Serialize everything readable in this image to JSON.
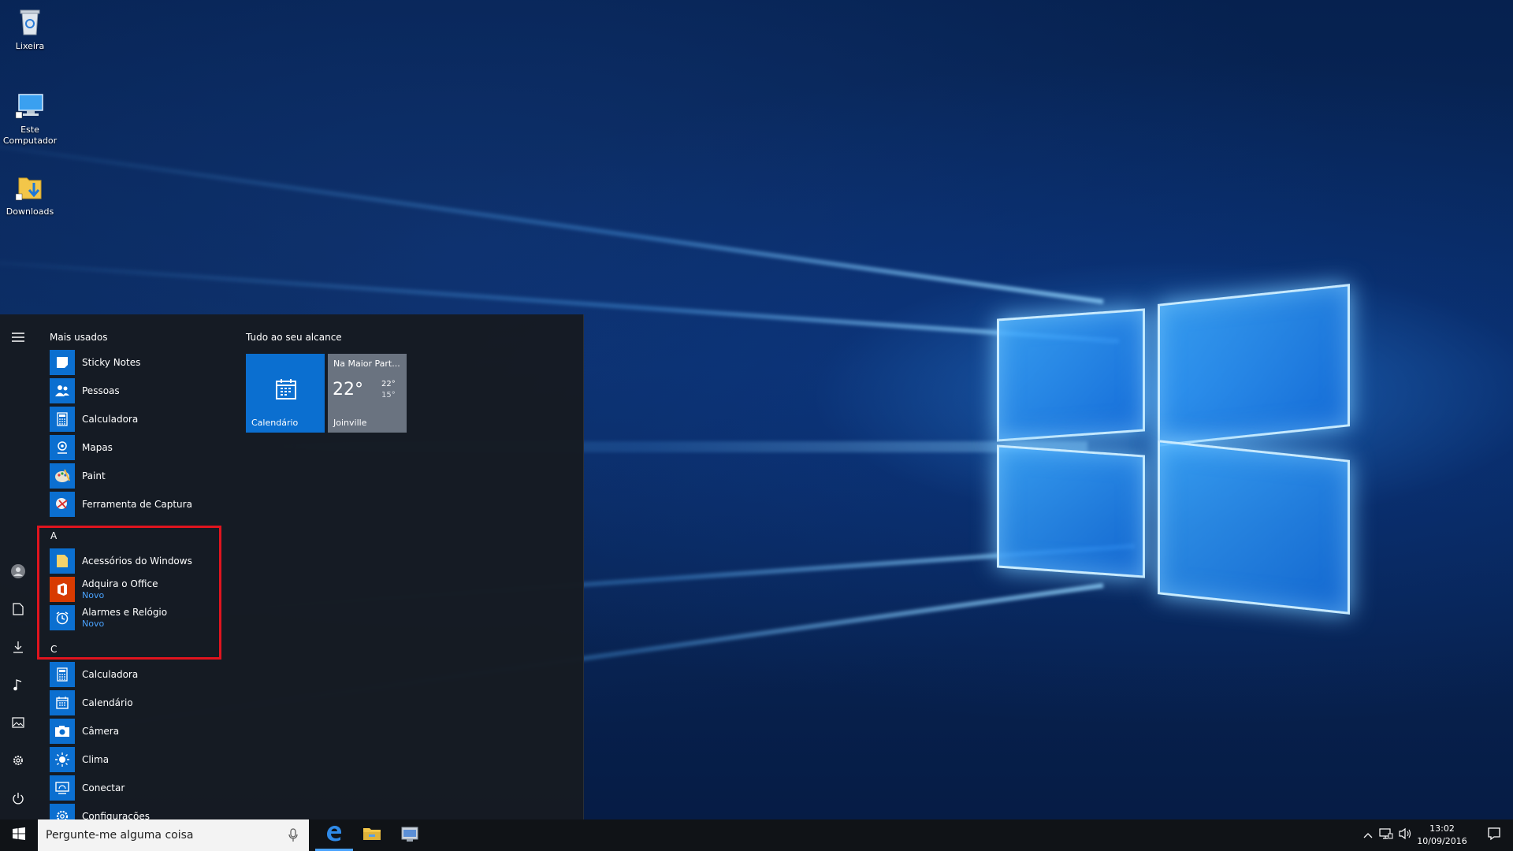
{
  "desktop": {
    "icons": [
      {
        "label": "Lixeira"
      },
      {
        "label": "Este Computador"
      },
      {
        "label": "Downloads"
      }
    ]
  },
  "start_menu": {
    "most_used_title": "Mais usados",
    "most_used": [
      {
        "label": "Sticky Notes"
      },
      {
        "label": "Pessoas"
      },
      {
        "label": "Calculadora"
      },
      {
        "label": "Mapas"
      },
      {
        "label": "Paint"
      },
      {
        "label": "Ferramenta de Captura"
      }
    ],
    "letter_a": "A",
    "group_a": [
      {
        "label": "Acessórios do Windows",
        "sub": ""
      },
      {
        "label": "Adquira o Office",
        "sub": "Novo"
      },
      {
        "label": "Alarmes e Relógio",
        "sub": "Novo"
      }
    ],
    "letter_c": "C",
    "group_c": [
      {
        "label": "Calculadora"
      },
      {
        "label": "Calendário"
      },
      {
        "label": "Câmera"
      },
      {
        "label": "Clima"
      },
      {
        "label": "Conectar"
      },
      {
        "label": "Configurações"
      }
    ],
    "tiles_title": "Tudo ao seu alcance",
    "tiles": {
      "calendar": {
        "label": "Calendário"
      },
      "weather": {
        "condition": "Na Maior Part...",
        "temp": "22°",
        "high": "22°",
        "low": "15°",
        "city": "Joinville"
      }
    }
  },
  "taskbar": {
    "search_placeholder": "Pergunte-me alguma coisa",
    "time": "13:02",
    "date": "10/09/2016"
  },
  "colors": {
    "accent": "#0b6fd0",
    "office": "#d83b01",
    "weather_tile": "#6a7380",
    "highlight": "#e0141e"
  }
}
